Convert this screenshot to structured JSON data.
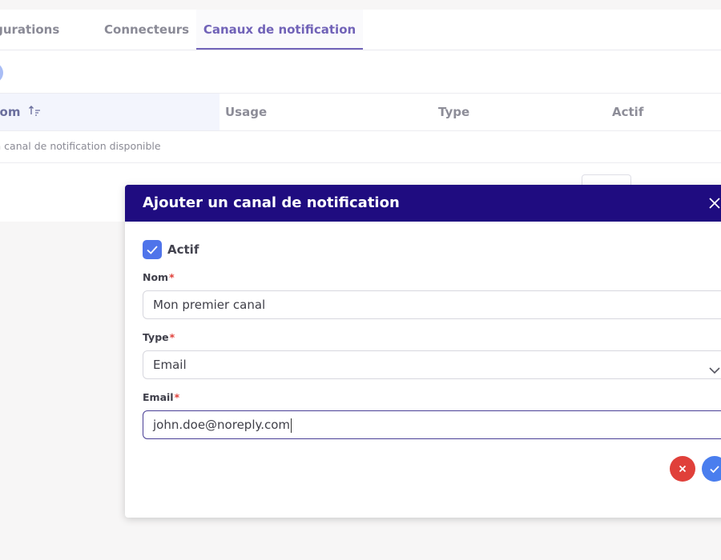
{
  "tabs": [
    {
      "label": "Configurations"
    },
    {
      "label": "Connecteurs"
    },
    {
      "label": "Canaux de notification"
    }
  ],
  "table": {
    "columns": [
      "Nom",
      "Usage",
      "Type",
      "Actif"
    ],
    "empty_message": "Aucun canal de notification disponible"
  },
  "dialog": {
    "title": "Ajouter un canal de notification",
    "active_checkbox": {
      "label": "Actif",
      "checked": true
    },
    "fields": {
      "name": {
        "label": "Nom",
        "required_mark": "*",
        "value": "Mon premier canal"
      },
      "type": {
        "label": "Type",
        "required_mark": "*",
        "value": "Email"
      },
      "email": {
        "label": "Email",
        "required_mark": "*",
        "value": "john.doe@noreply.com"
      }
    }
  },
  "colors": {
    "dialog_header": "#1f0c80",
    "active_tab": "#7163b8",
    "checkbox": "#4f74ea",
    "cancel_button": "#e0403a",
    "confirm_button": "#4a7eee"
  },
  "icons": {
    "sort": "sort-ascending-icon",
    "close": "close-icon",
    "chevron": "chevron-down-icon",
    "check": "check-icon",
    "cancel": "x-icon"
  }
}
